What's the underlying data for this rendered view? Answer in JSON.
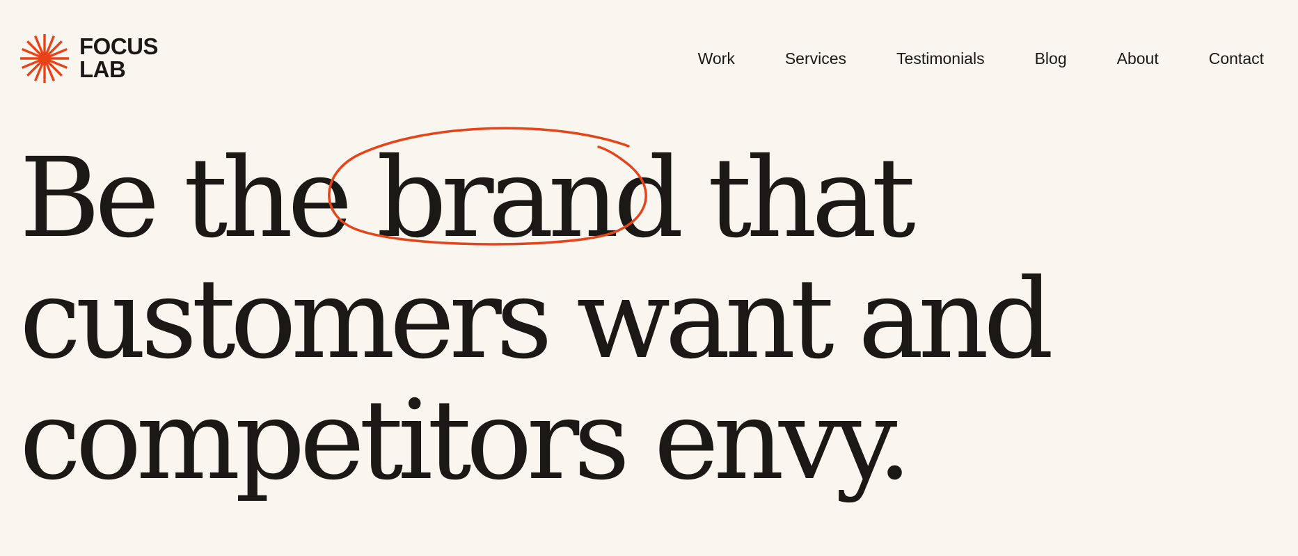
{
  "brand": {
    "name_line1": "FOCUS",
    "name_line2": "LAB",
    "logo_icon": "sunburst-icon",
    "accent_color": "#e84318"
  },
  "nav": {
    "items": [
      {
        "label": "Work"
      },
      {
        "label": "Services"
      },
      {
        "label": "Testimonials"
      },
      {
        "label": "Blog"
      },
      {
        "label": "About"
      },
      {
        "label": "Contact"
      }
    ]
  },
  "hero": {
    "line1_before": "Be the ",
    "line1_highlight": "brand",
    "line1_after": " that",
    "line2": "customers want and",
    "line3": "competitors envy.",
    "annotation_icon": "hand-drawn-circle",
    "annotation_color": "#e84318"
  },
  "colors": {
    "background": "#f9f6f0",
    "text": "#1b1915",
    "accent": "#e84318"
  }
}
